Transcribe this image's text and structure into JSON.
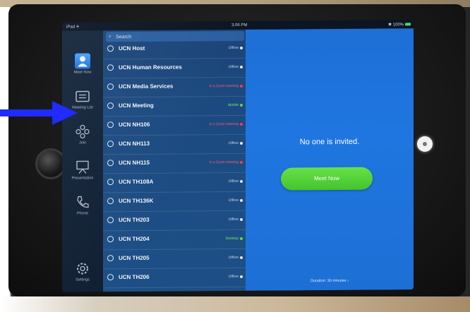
{
  "status_bar": {
    "left": "iPad ✈",
    "time": "3:06 PM",
    "right": "✱ 100%"
  },
  "nav": [
    {
      "name": "nav-meet-now",
      "label": "Meet Now",
      "icon": "meet-now-icon"
    },
    {
      "name": "nav-meeting-list",
      "label": "Meeting List",
      "icon": "meeting-list-icon"
    },
    {
      "name": "nav-join",
      "label": "Join",
      "icon": "join-icon"
    },
    {
      "name": "nav-presentation",
      "label": "Presentation",
      "icon": "presentation-icon"
    },
    {
      "name": "nav-phone",
      "label": "Phone",
      "icon": "phone-icon"
    },
    {
      "name": "nav-settings",
      "label": "Settings",
      "icon": "settings-icon"
    }
  ],
  "search": {
    "placeholder": "Search"
  },
  "contacts": [
    {
      "name": "UCN Host",
      "status": "Offline",
      "kind": "offline"
    },
    {
      "name": "UCN Human Resources",
      "status": "Offline",
      "kind": "offline"
    },
    {
      "name": "UCN Media Services",
      "status": "In a Zoom meeting",
      "kind": "zoom"
    },
    {
      "name": "UCN Meeting",
      "status": "Mobile",
      "kind": "mobile"
    },
    {
      "name": "UCN NH106",
      "status": "In a Zoom meeting",
      "kind": "zoom"
    },
    {
      "name": "UCN NH113",
      "status": "Offline",
      "kind": "offline"
    },
    {
      "name": "UCN NH115",
      "status": "In a Zoom meeting",
      "kind": "zoom"
    },
    {
      "name": "UCN TH108A",
      "status": "Offline",
      "kind": "offline"
    },
    {
      "name": "UCN TH136K",
      "status": "Offline",
      "kind": "offline"
    },
    {
      "name": "UCN TH203",
      "status": "Offline",
      "kind": "offline"
    },
    {
      "name": "UCN TH204",
      "status": "Desktop",
      "kind": "desktop"
    },
    {
      "name": "UCN TH205",
      "status": "Offline",
      "kind": "offline"
    },
    {
      "name": "UCN TH206",
      "status": "Offline",
      "kind": "offline"
    }
  ],
  "detail": {
    "message": "No one is invited.",
    "meet_now_label": "Meet Now",
    "duration": "Duration: 30 minutes ›"
  },
  "colors": {
    "arrow": "#1f2bff",
    "meet_now": "#4fd134",
    "panel_blue": "#1f74dd"
  }
}
